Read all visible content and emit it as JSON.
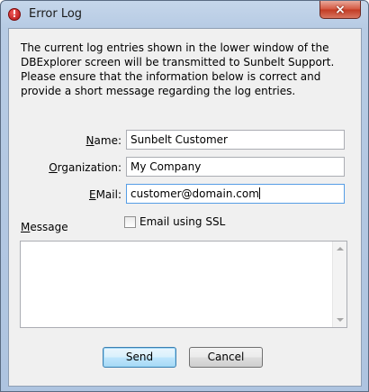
{
  "window": {
    "title": "Error Log",
    "close_glyph": "×",
    "icon": "error-icon"
  },
  "description": "The current log entries shown in the lower window of the DBExplorer screen will be transmitted to Sunbelt Support.  Please ensure that the information below is correct and provide a short message regarding the log entries.",
  "form": {
    "name": {
      "label_mnemonic": "N",
      "label_rest": "ame:",
      "value": "Sunbelt Customer"
    },
    "organization": {
      "label_mnemonic": "O",
      "label_rest": "rganization:",
      "value": "My Company"
    },
    "email": {
      "label_mnemonic": "E",
      "label_rest": "Mail:",
      "value": "customer@domain.com"
    },
    "ssl": {
      "label": "Email using SSL",
      "checked": false
    },
    "message": {
      "label_mnemonic": "M",
      "label_rest": "essage",
      "value": ""
    }
  },
  "buttons": {
    "send": "Send",
    "cancel": "Cancel"
  },
  "colors": {
    "title_bar": "#b7cbe4",
    "close_button": "#c23a22",
    "default_button_border": "#3c7fb1"
  }
}
